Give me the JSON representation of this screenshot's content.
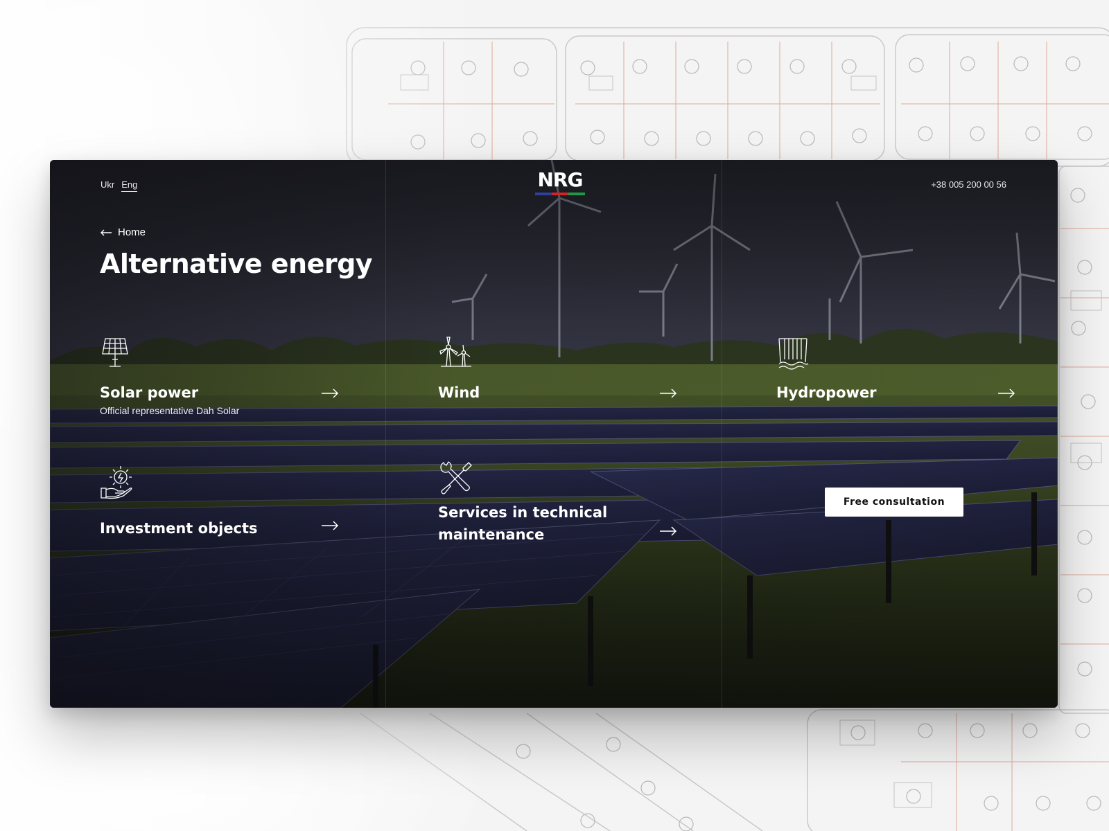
{
  "header": {
    "languages": [
      "Ukr",
      "Eng"
    ],
    "active_language": "Eng",
    "logo_text": "NRG",
    "logo_colors": [
      "#2f3f9e",
      "#d2232a",
      "#1e9a46"
    ],
    "phone": "+38 005 200 00 56"
  },
  "breadcrumb": {
    "back_label": "Home"
  },
  "page": {
    "title": "Alternative energy"
  },
  "categories": [
    {
      "name": "Solar power",
      "subtitle": "Official representative Dah Solar",
      "icon": "solar-panel-icon"
    },
    {
      "name": "Wind",
      "subtitle": "",
      "icon": "wind-turbine-icon"
    },
    {
      "name": "Hydropower",
      "subtitle": "",
      "icon": "hydropower-icon"
    },
    {
      "name": "Investment objects",
      "subtitle": "",
      "icon": "investment-hand-icon"
    },
    {
      "name": "Services in technical maintenance",
      "subtitle": "",
      "icon": "wrench-screwdriver-icon"
    }
  ],
  "cta": {
    "label": "Free consultation"
  },
  "colors": {
    "text": "#ffffff",
    "card_bg": "#2b2a33",
    "cta_bg": "#ffffff"
  }
}
